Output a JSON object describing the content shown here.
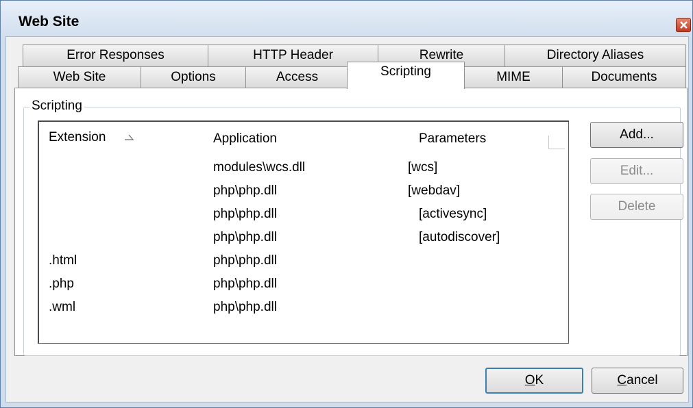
{
  "window": {
    "title": "Web Site"
  },
  "tabs_row_top": [
    {
      "label": "Error Responses"
    },
    {
      "label": "HTTP Header"
    },
    {
      "label": "Rewrite"
    },
    {
      "label": "Directory Aliases"
    }
  ],
  "tabs_row_bottom": [
    {
      "label": "Web Site"
    },
    {
      "label": "Options"
    },
    {
      "label": "Access"
    },
    {
      "label": "Scripting",
      "selected": true
    },
    {
      "label": "MIME"
    },
    {
      "label": "Documents"
    }
  ],
  "scripting": {
    "group_label": "Scripting",
    "columns": {
      "extension": "Extension",
      "application": "Application",
      "parameters": "Parameters"
    },
    "rows": [
      {
        "extension": "",
        "application": "modules\\wcs.dll",
        "parameters": "[wcs]"
      },
      {
        "extension": "",
        "application": "php\\php.dll",
        "parameters": "[webdav]"
      },
      {
        "extension": "",
        "application": "php\\php.dll",
        "parameters": "[activesync]"
      },
      {
        "extension": "",
        "application": "php\\php.dll",
        "parameters": "[autodiscover]"
      },
      {
        "extension": ".html",
        "application": "php\\php.dll",
        "parameters": ""
      },
      {
        "extension": ".php",
        "application": "php\\php.dll",
        "parameters": ""
      },
      {
        "extension": ".wml",
        "application": "php\\php.dll",
        "parameters": ""
      }
    ],
    "buttons": {
      "add": "Add...",
      "edit": "Edit...",
      "delete": "Delete"
    }
  },
  "footer": {
    "ok_accel": "O",
    "ok_rest": "K",
    "cancel_accel": "C",
    "cancel_rest": "ancel"
  },
  "icons": {
    "close": "close-icon",
    "sort": "sort-ascending-icon"
  }
}
